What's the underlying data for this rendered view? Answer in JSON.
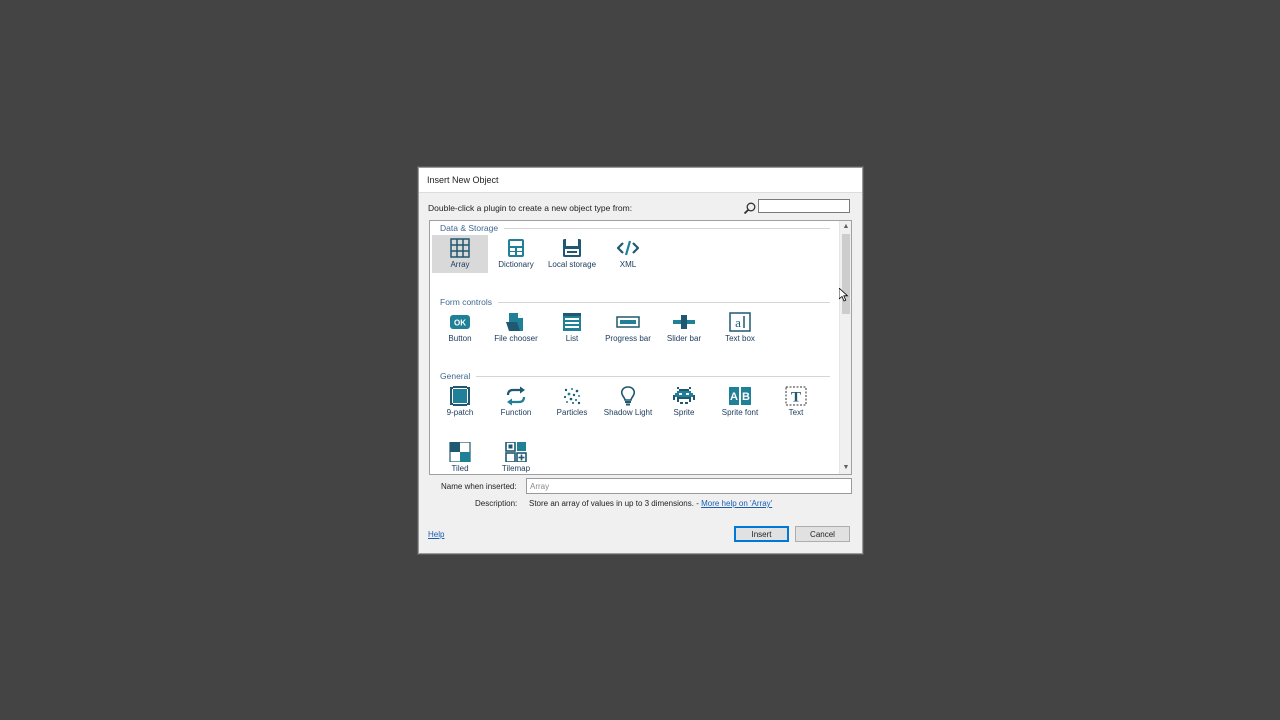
{
  "dialog": {
    "title": "Insert New Object",
    "prompt": "Double-click a plugin to create a new object type from:",
    "search": {
      "value": "",
      "icon": "magnifier-icon"
    }
  },
  "categories": [
    {
      "label": "Data & Storage",
      "items": [
        {
          "label": "Array",
          "icon": "grid-icon",
          "selected": true
        },
        {
          "label": "Dictionary",
          "icon": "dictionary-icon"
        },
        {
          "label": "Local storage",
          "icon": "local-storage-icon"
        },
        {
          "label": "XML",
          "icon": "xml-code-icon"
        }
      ]
    },
    {
      "label": "Form controls",
      "items": [
        {
          "label": "Button",
          "icon": "ok-button-icon"
        },
        {
          "label": "File chooser",
          "icon": "file-icon"
        },
        {
          "label": "List",
          "icon": "list-icon"
        },
        {
          "label": "Progress bar",
          "icon": "progress-bar-icon"
        },
        {
          "label": "Slider bar",
          "icon": "slider-icon"
        },
        {
          "label": "Text box",
          "icon": "text-box-icon"
        }
      ]
    },
    {
      "label": "General",
      "items": [
        {
          "label": "9-patch",
          "icon": "nine-patch-icon"
        },
        {
          "label": "Function",
          "icon": "function-arrows-icon"
        },
        {
          "label": "Particles",
          "icon": "particles-icon"
        },
        {
          "label": "Shadow Light",
          "icon": "lightbulb-icon"
        },
        {
          "label": "Sprite",
          "icon": "space-invader-icon"
        },
        {
          "label": "Sprite font",
          "icon": "sprite-font-icon"
        },
        {
          "label": "Text",
          "icon": "text-t-icon"
        },
        {
          "label": "Tiled",
          "icon": "tiled-icon"
        },
        {
          "label": "Tilemap",
          "icon": "tilemap-icon"
        }
      ]
    }
  ],
  "footer": {
    "name_label": "Name when inserted:",
    "name_value": "Array",
    "description_label": "Description:",
    "description_text": "Store an array of values in up to 3 dimensions. - ",
    "description_link": "More help on 'Array'",
    "help_label": "Help",
    "insert_label": "Insert",
    "cancel_label": "Cancel"
  },
  "colors": {
    "icon": "#1f8098",
    "category_header": "#3f6890",
    "link": "#1a5fb4"
  }
}
